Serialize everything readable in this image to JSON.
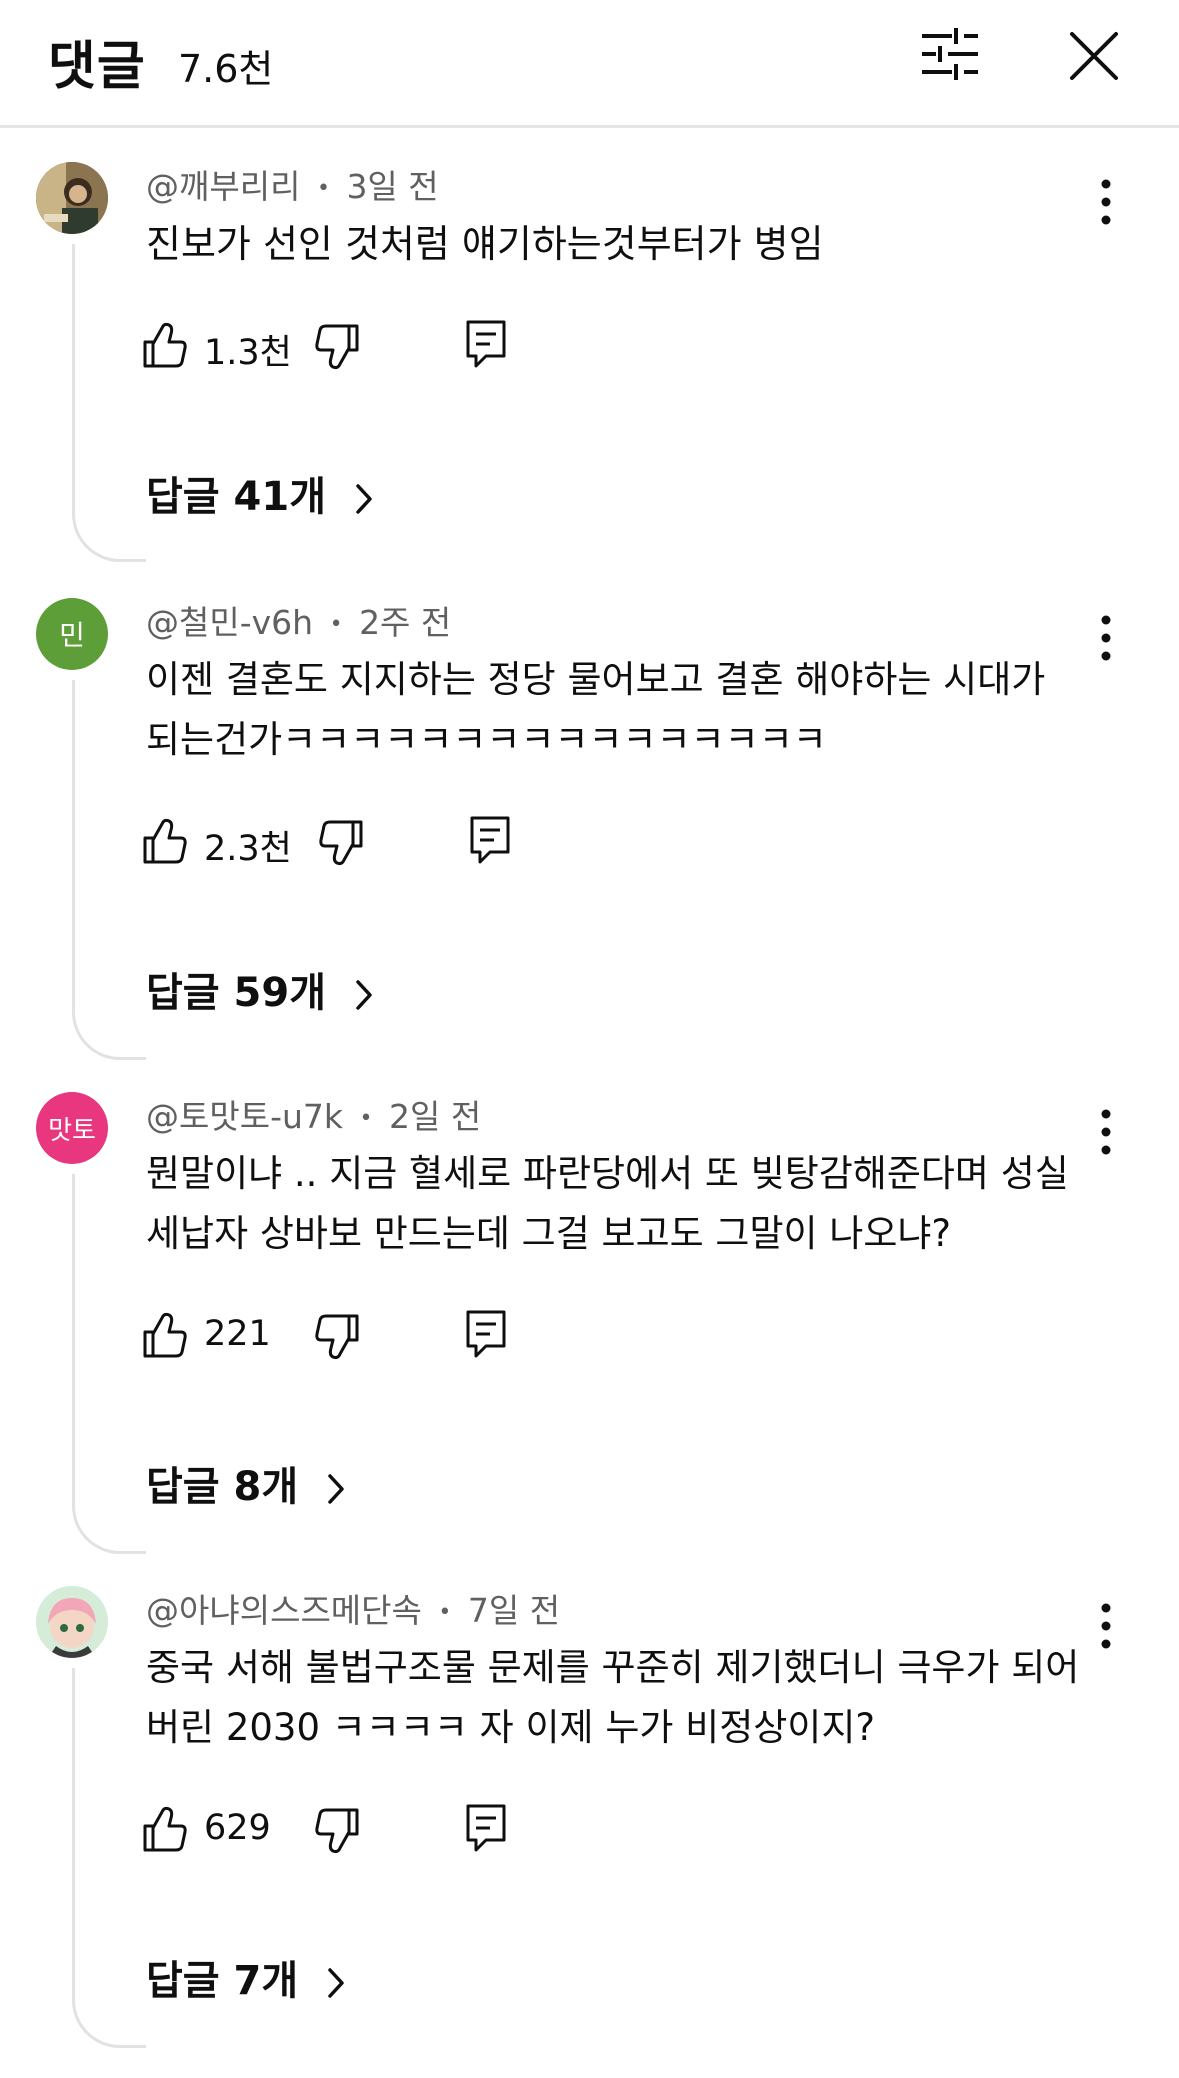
{
  "header": {
    "title": "댓글",
    "count": "7.6천"
  },
  "icons": {
    "filter": "filter-sliders-icon",
    "close": "close-icon",
    "more": "more-vertical-icon",
    "like": "thumbs-up-icon",
    "dislike": "thumbs-down-icon",
    "reply": "reply-comment-icon"
  },
  "comments": [
    {
      "author": "@깨부리리",
      "time": "3일 전",
      "text": "진보가 선인 것처럼 얘기하는것부터가 병임",
      "likes": "1.3천",
      "replies": "답글 41개"
    },
    {
      "author": "@철민-v6h",
      "time": "2주 전",
      "avatar_text": "민",
      "avatar_color": "#5e9e38",
      "text": "이젠 결혼도 지지하는 정당 물어보고 결혼 해야하는 시대가 되는건가ㅋㅋㅋㅋㅋㅋㅋㅋㅋㅋㅋㅋㅋㅋㅋㅋ",
      "likes": "2.3천",
      "replies": "답글 59개"
    },
    {
      "author": "@토맛토-u7k",
      "time": "2일 전",
      "avatar_text": "맛토",
      "avatar_color": "#e8377e",
      "text": "뭔말이냐 .. 지금 혈세로 파란당에서 또 빚탕감해준다며 성실세납자 상바보 만드는데 그걸 보고도 그말이 나오냐?",
      "likes": "221",
      "replies": "답글 8개"
    },
    {
      "author": "@아냐의스즈메단속",
      "time": "7일 전",
      "text": "중국 서해 불법구조물 문제를 꾸준히 제기했더니 극우가 되어버린 2030 ㅋㅋㅋㅋ  자 이제 누가 비정상이지?",
      "likes": "629",
      "replies": "답글 7개"
    }
  ],
  "separator": "•"
}
